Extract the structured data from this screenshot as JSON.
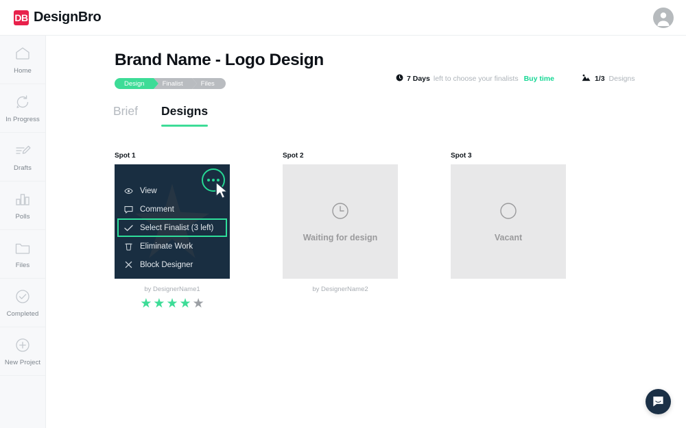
{
  "brand": {
    "badge": "DB",
    "name": "DesignBro",
    "badge_color": "#e8214b"
  },
  "topbar": {
    "avatar_icon": "user-avatar-icon"
  },
  "sidebar": {
    "items": [
      {
        "label": "Home",
        "icon": "home-icon"
      },
      {
        "label": "In Progress",
        "icon": "refresh-circle-icon"
      },
      {
        "label": "Drafts",
        "icon": "pencil-edit-icon"
      },
      {
        "label": "Polls",
        "icon": "bar-chart-icon"
      },
      {
        "label": "Files",
        "icon": "folder-icon"
      },
      {
        "label": "Completed",
        "icon": "check-circle-icon"
      },
      {
        "label": "New Project",
        "icon": "plus-circle-icon"
      }
    ]
  },
  "page": {
    "title": "Brand Name - Logo Design"
  },
  "breadcrumb": {
    "steps": [
      {
        "label": "Design",
        "active": true
      },
      {
        "label": "Finalist",
        "active": false
      },
      {
        "label": "Files",
        "active": false
      }
    ],
    "active_color": "#3ddc97",
    "inactive_color": "#b9bcc0"
  },
  "status": {
    "clock_icon": "clock-icon",
    "days_value": "7 Days",
    "days_text": "left to choose your finalists",
    "buy_time_label": "Buy time",
    "buy_time_color": "#16d794",
    "designs_icon": "image-icon",
    "designs_count": "1/3",
    "designs_label": "Designs"
  },
  "tabs": [
    {
      "label": "Brief",
      "active": false
    },
    {
      "label": "Designs",
      "active": true
    }
  ],
  "spots": [
    {
      "label": "Spot 1",
      "state": "menu-open",
      "designer": "by DesignerName1",
      "rating": 4,
      "rating_max": 5,
      "menu": {
        "dots_icon": "three-dots-icon",
        "cursor_icon": "mouse-cursor-icon",
        "items": [
          {
            "label": "View",
            "icon": "eye-icon",
            "highlight": false
          },
          {
            "label": "Comment",
            "icon": "comment-bubble-icon",
            "highlight": false
          },
          {
            "label": "Select Finalist (3 left)",
            "icon": "check-icon",
            "highlight": true
          },
          {
            "label": "Eliminate Work",
            "icon": "trash-icon",
            "highlight": false
          },
          {
            "label": "Block Designer",
            "icon": "close-x-icon",
            "highlight": false
          }
        ]
      }
    },
    {
      "label": "Spot 2",
      "state": "waiting",
      "placeholder_icon": "clock-outline-icon",
      "placeholder_text": "Waiting for design",
      "designer": "by DesignerName2"
    },
    {
      "label": "Spot 3",
      "state": "vacant",
      "placeholder_icon": "empty-circle-icon",
      "placeholder_text": "Vacant",
      "designer": ""
    }
  ],
  "chat": {
    "icon": "chat-bubble-icon",
    "color": "#1b3046"
  }
}
